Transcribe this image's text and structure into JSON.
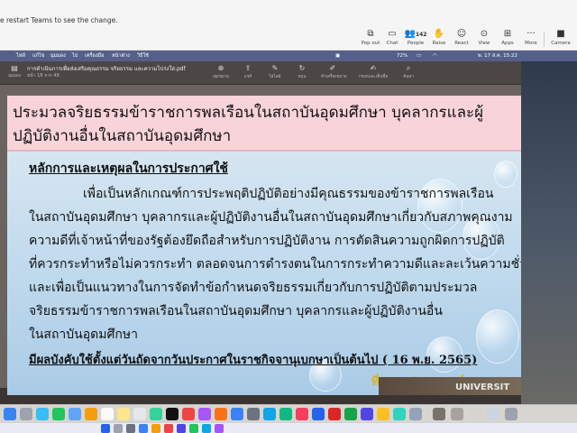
{
  "teams": {
    "notice": "e restart Teams to see the change.",
    "buttons": [
      {
        "label": "Pop out",
        "icon": "pop-out-icon"
      },
      {
        "label": "Chat",
        "icon": "chat-icon"
      },
      {
        "label": "People",
        "icon": "people-icon",
        "count": "142"
      },
      {
        "label": "Raise",
        "icon": "raise-hand-icon"
      },
      {
        "label": "React",
        "icon": "react-icon"
      },
      {
        "label": "View",
        "icon": "view-icon"
      },
      {
        "label": "Apps",
        "icon": "apps-icon"
      },
      {
        "label": "More",
        "icon": "more-icon"
      },
      {
        "label": "Camera",
        "icon": "camera-icon"
      }
    ]
  },
  "mac_menubar": {
    "items": [
      "ไฟล์",
      "แก้ไข",
      "มุมมอง",
      "ไป",
      "เครื่องมือ",
      "หน้าต่าง",
      "วิธีใช้"
    ],
    "battery": "72%",
    "datetime": "พ. 17 ส.ค. 15:22"
  },
  "viewer": {
    "sidebar_label": "มุมมอง",
    "title": "การดำเนินการเพื่อส่งเสริมคุณธรรม จริยธรรม และความโปร่งใส.pdf",
    "pages": "หน้า 18 จาก 48",
    "tools": [
      {
        "label": "ย่อ/ขยาย",
        "icon": "zoom-icon"
      },
      {
        "label": "แชร์",
        "icon": "share-icon"
      },
      {
        "label": "ไฮไลต์",
        "icon": "highlight-icon"
      },
      {
        "label": "หมุน",
        "icon": "rotate-icon"
      },
      {
        "label": "ทำเครื่องหมาย",
        "icon": "markup-icon"
      },
      {
        "label": "กรอกและเซ็นชื่อ",
        "icon": "sign-icon"
      },
      {
        "label": "ค้นหา",
        "icon": "search-icon"
      }
    ]
  },
  "slide": {
    "heading": "ประมวลจริยธรรมข้าราชการพลเรือนในสถาบันอุดมศึกษา บุคลากรและผู้ปฏิบัติงานอื่นในสถาบันอุดมศึกษา",
    "section_heading": "หลักการและเหตุผลในการประกาศใช้",
    "lines": [
      "เพื่อเป็นหลักเกณฑ์การประพฤติปฏิบัติอย่างมีคุณธรรมของข้าราชการพลเรือน",
      "ในสถาบันอุดมศึกษา บุคลากรและผู้ปฏิบัติงานอื่นในสถาบันอุดมศึกษาเกี่ยวกับสภาพคุณงาม",
      "ความดีที่เจ้าหน้าที่ของรัฐต้องยึดถือสำหรับการปฏิบัติงาน การตัดสินความถูกผิดการปฏิบัติ",
      "ที่ควรกระทำหรือไม่ควรกระทำ ตลอดจนการดำรงตนในการกระทำความดีและละเว้นความชั่ว",
      "และเพื่อเป็นแนวทางในการจัดทำข้อกำหนดจริยธรรมเกี่ยวกับการปฏิบัติตามประมวล",
      "จริยธรรมข้าราชการพลเรือนในสถาบันอุดมศึกษา บุคลากรและผู้ปฏิบัติงานอื่น",
      "ในสถาบันอุดมศึกษา"
    ],
    "effective": "มีผลบังคับใช้ตั้งแต่วันถัดจากวันประกาศในราชกิจจานุเบกษาเป็นต้นไป ( 16 พ.ย. 2565)",
    "source": "ที่มา:อ.ประฐมพงษ์ ทองรอด"
  },
  "desktop_text": "UNIVERSIT"
}
